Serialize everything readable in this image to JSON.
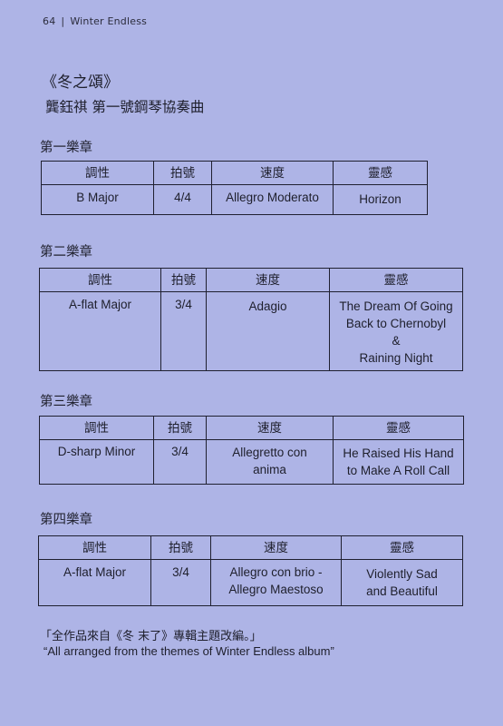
{
  "header": {
    "page_number": "64",
    "separator": "|",
    "book_title": "Winter Endless"
  },
  "title": "《冬之頌》",
  "subtitle": "龔鈺祺 第一號鋼琴協奏曲",
  "column_headers": [
    "調性",
    "拍號",
    "速度",
    "靈感"
  ],
  "movements": [
    {
      "heading": "第一樂章",
      "key": "B Major",
      "time": "4/4",
      "tempo": [
        "Allegro Moderato"
      ],
      "inspiration": [
        "Horizon"
      ]
    },
    {
      "heading": "第二樂章",
      "key": "A-flat Major",
      "time": "3/4",
      "tempo": [
        "Adagio"
      ],
      "inspiration": [
        "The Dream Of Going",
        "Back to Chernobyl",
        "&",
        "Raining Night"
      ]
    },
    {
      "heading": "第三樂章",
      "key": "D-sharp Minor",
      "time": "3/4",
      "tempo": [
        "Allegretto con",
        "anima"
      ],
      "inspiration": [
        "He Raised His Hand",
        "to Make A Roll Call"
      ]
    },
    {
      "heading": "第四樂章",
      "key": "A-flat Major",
      "time": "3/4",
      "tempo": [
        "Allegro con brio -",
        "Allegro Maestoso"
      ],
      "inspiration": [
        "Violently Sad",
        "and Beautiful"
      ]
    }
  ],
  "footer": {
    "note_zh": "「全作品來自《冬 末了》專輯主題改編。」",
    "note_en": "“All arranged from the themes of Winter Endless album”"
  }
}
